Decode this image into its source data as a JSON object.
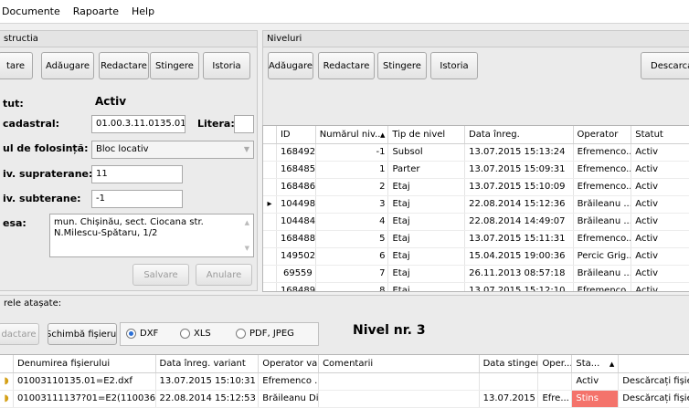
{
  "menu": [
    "Documente",
    "Rapoarte",
    "Help"
  ],
  "left": {
    "title": "structia",
    "buttons": [
      "tare",
      "Adăugare",
      "Redactare",
      "Stingere",
      "Istoria"
    ],
    "status_label": "tut:",
    "status_value": "Activ",
    "cadastral_label": "cadastral:",
    "cadastral_value": "01.00.3.11.0135.01",
    "litera_label": "Litera:",
    "litera_value": "",
    "folosinta_label": "ul de folosință:",
    "folosinta_value": "Bloc locativ",
    "supra_label": "iv. supraterane:",
    "supra_value": "11",
    "sub_label": "iv. subterane:",
    "sub_value": "-1",
    "adresa_label": "esa:",
    "adresa_value": "mun. Chișinău, sect. Ciocana str. N.Milescu-Spătaru, 1/2",
    "save": "Salvare",
    "cancel": "Anulare"
  },
  "right": {
    "title": "Niveluri",
    "buttons": [
      "Adăugare",
      "Redactare",
      "Stingere",
      "Istoria",
      "Descarca fi"
    ],
    "columns": [
      "ID",
      "Numărul niv...",
      "Tip de nivel",
      "Data înreg.",
      "Operator",
      "Statut"
    ],
    "rows": [
      [
        "168492",
        "-1",
        "Subsol",
        "13.07.2015 15:13:24",
        "Efremenco...",
        "Activ"
      ],
      [
        "168485",
        "1",
        "Parter",
        "13.07.2015 15:09:31",
        "Efremenco...",
        "Activ"
      ],
      [
        "168486",
        "2",
        "Etaj",
        "13.07.2015 15:10:09",
        "Efremenco...",
        "Activ"
      ],
      [
        "104498",
        "3",
        "Etaj",
        "22.08.2014 15:12:36",
        "Brăileanu ...",
        "Activ"
      ],
      [
        "104484",
        "4",
        "Etaj",
        "22.08.2014 14:49:07",
        "Brăileanu ...",
        "Activ"
      ],
      [
        "168488",
        "5",
        "Etaj",
        "13.07.2015 15:11:31",
        "Efremenco...",
        "Activ"
      ],
      [
        "149502",
        "6",
        "Etaj",
        "15.04.2015 19:00:36",
        "Percic Grig...",
        "Activ"
      ],
      [
        "69559",
        "7",
        "Etaj",
        "26.11.2013 08:57:18",
        "Brăileanu ...",
        "Activ"
      ],
      [
        "168489",
        "8",
        "Etaj",
        "13.07.2015 15:12:10",
        "Efremenco...",
        "Activ"
      ]
    ]
  },
  "bottom": {
    "title": "rele atașate:",
    "edit": "dactare",
    "change": "Schimbă fișierul",
    "radios": [
      "DXF",
      "XLS",
      "PDF, JPEG"
    ],
    "nivel": "Nivel nr. 3",
    "columns": [
      "Denumirea fișierului",
      "Data înreg. variant",
      "Operator va...",
      "Comentarii",
      "Data stingere",
      "Oper...",
      "Sta..."
    ],
    "rows": [
      [
        "01003110135.01=E2.dxf",
        "13.07.2015 15:10:31",
        "Efremenco ...",
        "",
        "",
        "",
        "Activ",
        "Descărcați fișierul"
      ],
      [
        "01003111137?01=E2(110036).dxf",
        "22.08.2014 15:12:53",
        "Brăileanu Di...",
        "",
        "13.07.2015",
        "Efre...",
        "Stins",
        "Descărcați fișierul"
      ]
    ]
  }
}
